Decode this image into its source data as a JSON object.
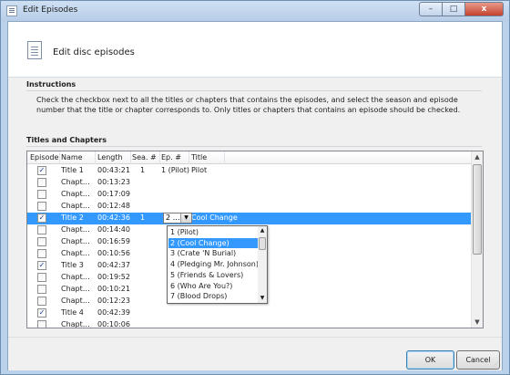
{
  "window": {
    "title": "Edit Episodes"
  },
  "header": {
    "text": "Edit disc episodes"
  },
  "instructions": {
    "heading": "Instructions",
    "body": "Check the checkbox next to all the titles or chapters that contains the episodes, and select the season and episode number that the title or chapter corresponds to. Only titles or chapters that contains an episode should be checked."
  },
  "titles_section": {
    "heading": "Titles and Chapters"
  },
  "columns": [
    "Episode",
    "Name",
    "Length",
    "Sea. #",
    "Ep. #",
    "Title"
  ],
  "rows": [
    {
      "checked": true,
      "name": "Title 1",
      "length": "00:43:21",
      "season": "1",
      "episode": "1 (Pilot)",
      "title": "Pilot"
    },
    {
      "checked": false,
      "name": "Chapt…",
      "length": "00:13:23",
      "season": "",
      "episode": "",
      "title": ""
    },
    {
      "checked": false,
      "name": "Chapt…",
      "length": "00:17:09",
      "season": "",
      "episode": "",
      "title": ""
    },
    {
      "checked": false,
      "name": "Chapt…",
      "length": "00:12:48",
      "season": "",
      "episode": "",
      "title": ""
    },
    {
      "checked": true,
      "name": "Title 2",
      "length": "00:42:36",
      "season": "1",
      "episode": "2 …",
      "title": "Cool Change",
      "selected": true
    },
    {
      "checked": false,
      "name": "Chapt…",
      "length": "00:14:40",
      "season": "",
      "episode": "",
      "title": ""
    },
    {
      "checked": false,
      "name": "Chapt…",
      "length": "00:16:59",
      "season": "",
      "episode": "",
      "title": ""
    },
    {
      "checked": false,
      "name": "Chapt…",
      "length": "00:10:56",
      "season": "",
      "episode": "",
      "title": ""
    },
    {
      "checked": true,
      "name": "Title 3",
      "length": "00:42:37",
      "season": "",
      "episode": "",
      "title": ""
    },
    {
      "checked": false,
      "name": "Chapt…",
      "length": "00:19:52",
      "season": "",
      "episode": "",
      "title": ""
    },
    {
      "checked": false,
      "name": "Chapt…",
      "length": "00:10:21",
      "season": "",
      "episode": "",
      "title": ""
    },
    {
      "checked": false,
      "name": "Chapt…",
      "length": "00:12:23",
      "season": "",
      "episode": "",
      "title": ""
    },
    {
      "checked": true,
      "name": "Title 4",
      "length": "00:42:39",
      "season": "",
      "episode": "",
      "title": ""
    },
    {
      "checked": false,
      "name": "Chapt…",
      "length": "00:10:06",
      "season": "",
      "episode": "",
      "title": ""
    }
  ],
  "dropdown": {
    "selected_value": "2 …",
    "options": [
      "1 (Pilot)",
      "2 (Cool Change)",
      "3 (Crate 'N Burial)",
      "4 (Pledging Mr. Johnson)",
      "5 (Friends & Lovers)",
      "6 (Who Are You?)",
      "7 (Blood Drops)"
    ],
    "selected_index": 1
  },
  "buttons": {
    "ok": "OK",
    "cancel": "Cancel"
  },
  "icons": {
    "check": "✓",
    "up": "▲",
    "down": "▼",
    "combo_arrow": "▼",
    "minimize": "–",
    "maximize": "□",
    "close": "x"
  }
}
